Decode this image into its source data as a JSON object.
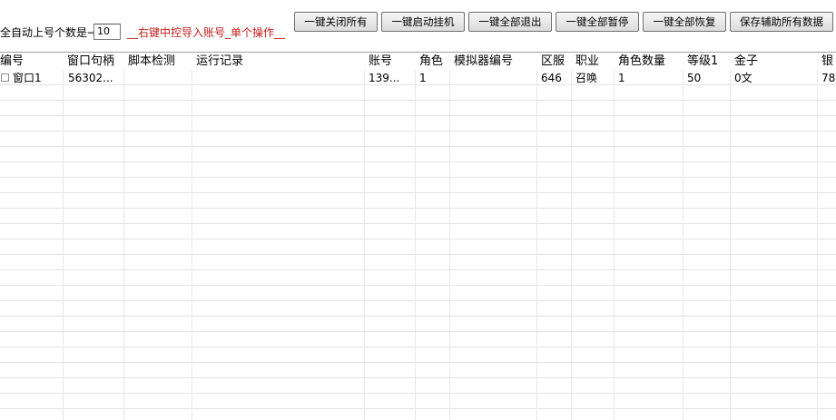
{
  "toolbar": {
    "count_label": "全自动上号个数是→",
    "count_value": "10",
    "hint": "__右键中控导入账号_单个操作__",
    "buttons": [
      "一键关闭所有",
      "一键启动挂机",
      "一键全部退出",
      "一键全部暂停",
      "一键全部恢复",
      "保存辅助所有数据"
    ]
  },
  "table": {
    "columns": [
      "编号",
      "窗口句柄",
      "脚本检测",
      "运行记录",
      "账号",
      "角色",
      "模拟器编号",
      "区服",
      "职业",
      "角色数量",
      "等级1",
      "金子",
      "银"
    ],
    "rows": [
      {
        "cells": [
          "窗口1",
          "56302...",
          "",
          "",
          "139...",
          "1",
          "",
          "646",
          "召唤",
          "1",
          "50",
          "0文",
          "78"
        ]
      }
    ]
  }
}
